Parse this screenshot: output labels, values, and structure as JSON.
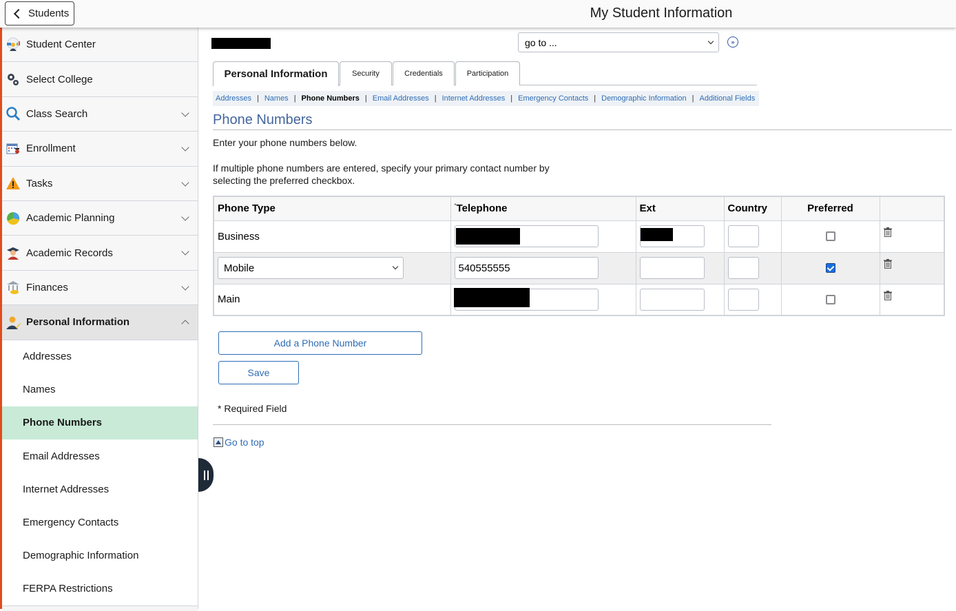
{
  "header": {
    "back_label": "Students",
    "title": "My Student Information"
  },
  "sidebar": {
    "items": [
      {
        "label": "Student Center",
        "icon": "student-center-icon",
        "expandable": false
      },
      {
        "label": "Select College",
        "icon": "gears-icon",
        "expandable": false
      },
      {
        "label": "Class Search",
        "icon": "search-icon",
        "expandable": true
      },
      {
        "label": "Enrollment",
        "icon": "calendar-icon",
        "expandable": true
      },
      {
        "label": "Tasks",
        "icon": "warning-icon",
        "expandable": true
      },
      {
        "label": "Academic Planning",
        "icon": "pie-chart-icon",
        "expandable": true
      },
      {
        "label": "Academic Records",
        "icon": "graduate-icon",
        "expandable": true
      },
      {
        "label": "Finances",
        "icon": "bank-icon",
        "expandable": true
      },
      {
        "label": "Personal Information",
        "icon": "person-edit-icon",
        "expandable": true,
        "expanded": true
      }
    ],
    "subitems": [
      {
        "label": "Addresses"
      },
      {
        "label": "Names"
      },
      {
        "label": "Phone Numbers",
        "active": true
      },
      {
        "label": "Email Addresses"
      },
      {
        "label": "Internet Addresses"
      },
      {
        "label": "Emergency Contacts"
      },
      {
        "label": "Demographic Information"
      },
      {
        "label": "FERPA Restrictions"
      }
    ]
  },
  "main": {
    "goto": {
      "selected": "go to ..."
    },
    "tabs": [
      {
        "label": "Personal Information",
        "active": true
      },
      {
        "label": "Security"
      },
      {
        "label": "Credentials"
      },
      {
        "label": "Participation"
      }
    ],
    "subtabs": [
      {
        "label": "Addresses"
      },
      {
        "label": "Names"
      },
      {
        "label": "Phone Numbers",
        "current": true
      },
      {
        "label": "Email Addresses"
      },
      {
        "label": "Internet Addresses"
      },
      {
        "label": "Emergency Contacts"
      },
      {
        "label": "Demographic Information"
      },
      {
        "label": "Additional Fields"
      }
    ],
    "section_title": "Phone Numbers",
    "intro": "Enter your phone numbers below.",
    "intro2": "If multiple phone numbers are entered, specify your primary contact number by selecting the preferred checkbox.",
    "table": {
      "headers": {
        "phone_type": "Phone Type",
        "telephone": "Telephone",
        "telephone_required_marker": "*",
        "ext": "Ext",
        "country": "Country",
        "preferred": "Preferred"
      },
      "rows": [
        {
          "phone_type": "Business",
          "telephone": "",
          "telephone_redacted": true,
          "ext": "",
          "ext_redacted": true,
          "country": "",
          "preferred": false,
          "editable_type": false
        },
        {
          "phone_type": "Mobile",
          "telephone": "540555555",
          "telephone_redacted": false,
          "ext": "",
          "ext_redacted": false,
          "country": "",
          "preferred": true,
          "editable_type": true
        },
        {
          "phone_type": "Main",
          "telephone": "",
          "telephone_redacted": true,
          "ext": "",
          "ext_redacted": false,
          "country": "",
          "preferred": false,
          "editable_type": false
        }
      ]
    },
    "add_button": "Add a Phone Number",
    "save_button": "Save",
    "required_note": "* Required Field",
    "go_to_top": "Go to top"
  },
  "colors": {
    "link": "#2f6db5",
    "section_title": "#44669e",
    "active_subnav": "#c8ead7",
    "left_accent": "#e04c1c",
    "checkbox_checked": "#1a6fe0"
  }
}
